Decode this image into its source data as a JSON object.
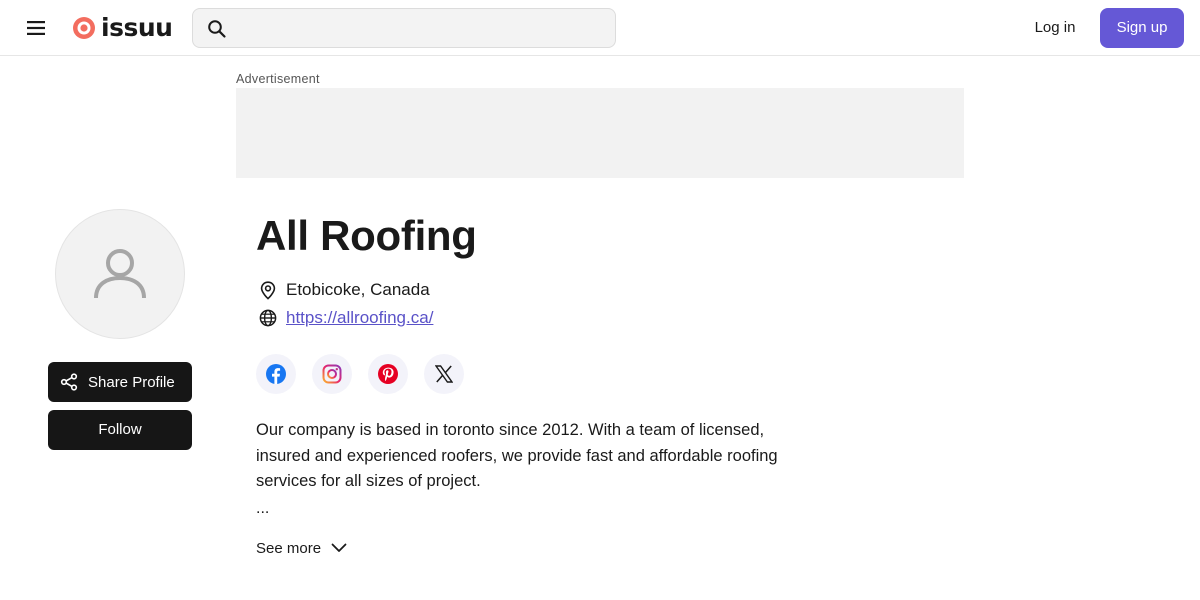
{
  "header": {
    "logo_text": "issuu",
    "search": {
      "placeholder": "",
      "value": ""
    },
    "login_label": "Log in",
    "signup_label": "Sign up",
    "accent_color": "#6558d6",
    "brand_color": "#f36d5f"
  },
  "ad": {
    "label": "Advertisement"
  },
  "sidebar": {
    "avatar_icon": "user-placeholder-icon",
    "share_label": "Share Profile",
    "follow_label": "Follow"
  },
  "profile": {
    "name": "All Roofing",
    "location": "Etobicoke, Canada",
    "website": "https://allroofing.ca/",
    "socials": [
      {
        "icon": "facebook-icon",
        "color": "#1877f2"
      },
      {
        "icon": "instagram-icon",
        "color": "#d6249f"
      },
      {
        "icon": "pinterest-icon",
        "color": "#e60023"
      },
      {
        "icon": "x-icon",
        "color": "#1a1a1a"
      }
    ],
    "bio": "Our company is based in toronto since 2012. With a team of licensed, insured and experienced roofers, we provide fast and affordable roofing services for all sizes of project.",
    "bio_ellipsis": "...",
    "see_more_label": "See more"
  }
}
